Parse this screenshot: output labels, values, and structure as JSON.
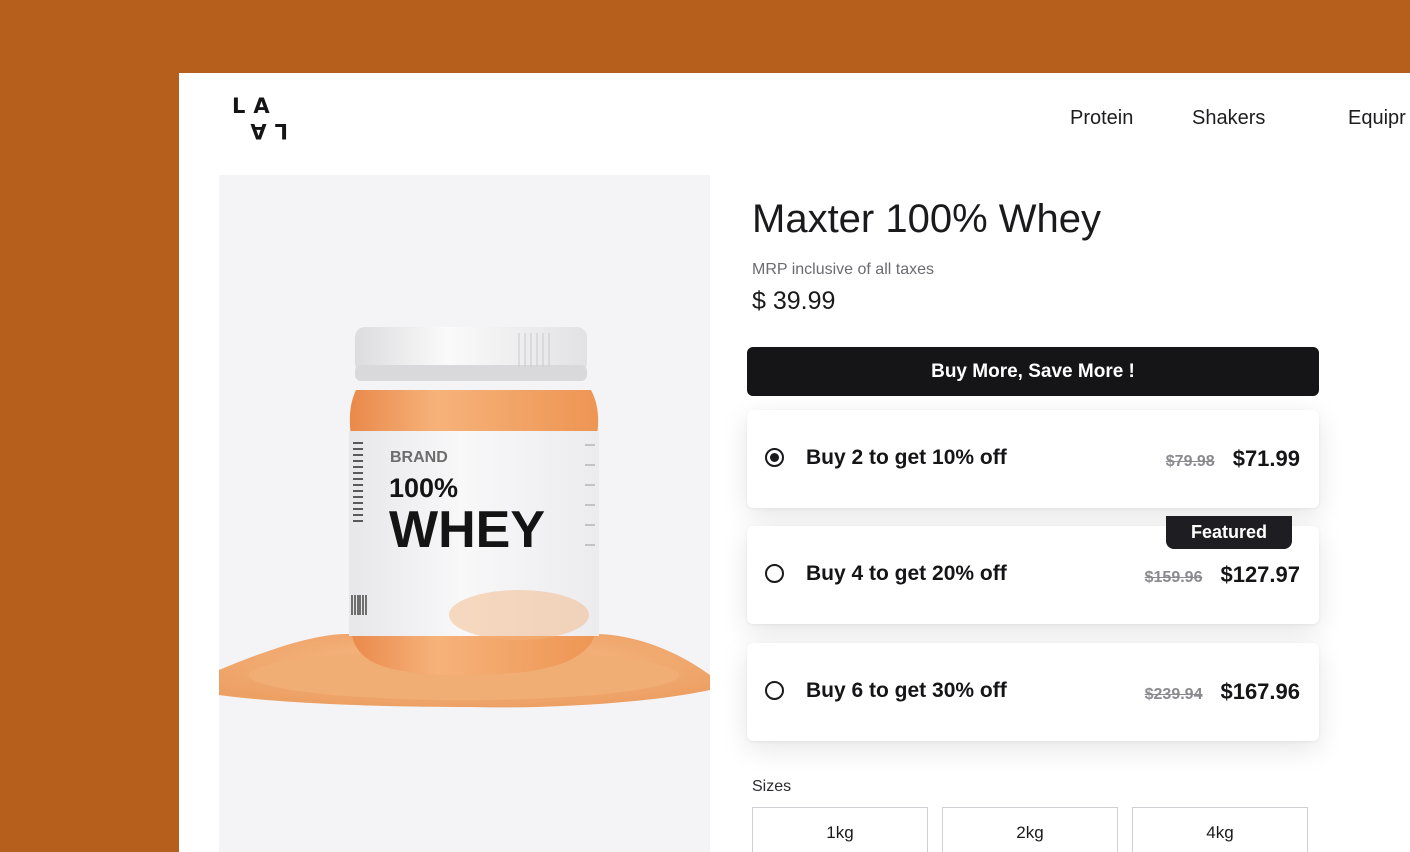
{
  "header": {
    "logo_top": "LA",
    "logo_bottom": "LA",
    "nav": [
      {
        "label": "Protein"
      },
      {
        "label": "Shakers"
      },
      {
        "label": "Equipr"
      }
    ]
  },
  "product": {
    "image_alt": "Whey protein jar on powder",
    "jar_brand": "BRAND",
    "jar_line1": "100%",
    "jar_line2": "WHEY",
    "title": "Maxter 100% Whey",
    "mrp_note": "MRP inclusive of all taxes",
    "price": "$ 39.99"
  },
  "bundles": {
    "banner": "Buy More, Save More !",
    "offers": [
      {
        "label": "Buy 2 to get 10% off",
        "old_price": "$79.98",
        "new_price": "$71.99",
        "selected": true
      },
      {
        "label": "Buy 4 to get 20% off",
        "old_price": "$159.96",
        "new_price": "$127.97",
        "badge": "Featured",
        "selected": false
      },
      {
        "label": "Buy 6 to get 30% off",
        "old_price": "$239.94",
        "new_price": "$167.96",
        "selected": false
      }
    ]
  },
  "sizes": {
    "label": "Sizes",
    "options": [
      {
        "label": "1kg"
      },
      {
        "label": "2kg"
      },
      {
        "label": "4kg"
      }
    ]
  },
  "colors": {
    "background": "#B65F1C",
    "jar_orange": "#F2A365",
    "dark": "#151517"
  }
}
